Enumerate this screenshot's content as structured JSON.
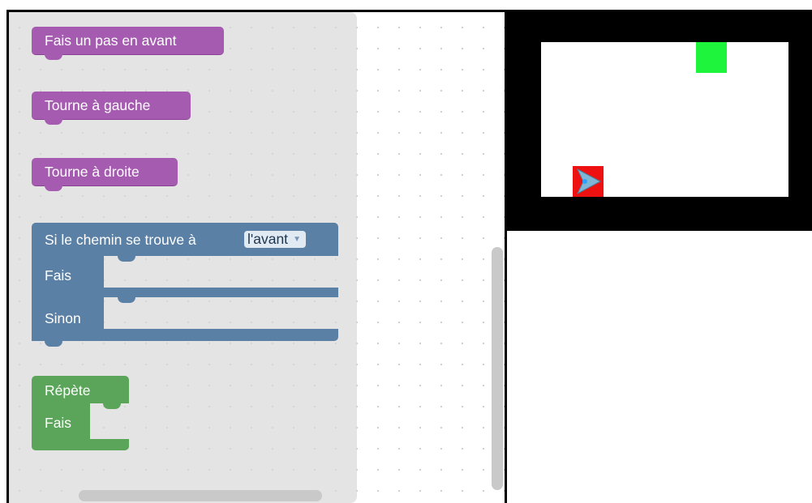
{
  "toolbox": {
    "move_forward_label": "Fais un pas en avant",
    "turn_left_label": "Tourne à gauche",
    "turn_right_label": "Tourne à droite",
    "if_path": {
      "prefix_label": "Si le chemin se trouve à",
      "direction_value": "l'avant",
      "do_label": "Fais",
      "else_label": "Sinon"
    },
    "repeat": {
      "label": "Répète",
      "do_label": "Fais"
    }
  },
  "colors": {
    "motion_block": "#a55cb0",
    "logic_block": "#5b80a5",
    "loop_block": "#5ba55b",
    "goal": "#1ef43b",
    "player": "#ee1111"
  },
  "stage": {
    "player_icon": "arrow-right-icon",
    "goal_icon": "green-square-goal"
  }
}
